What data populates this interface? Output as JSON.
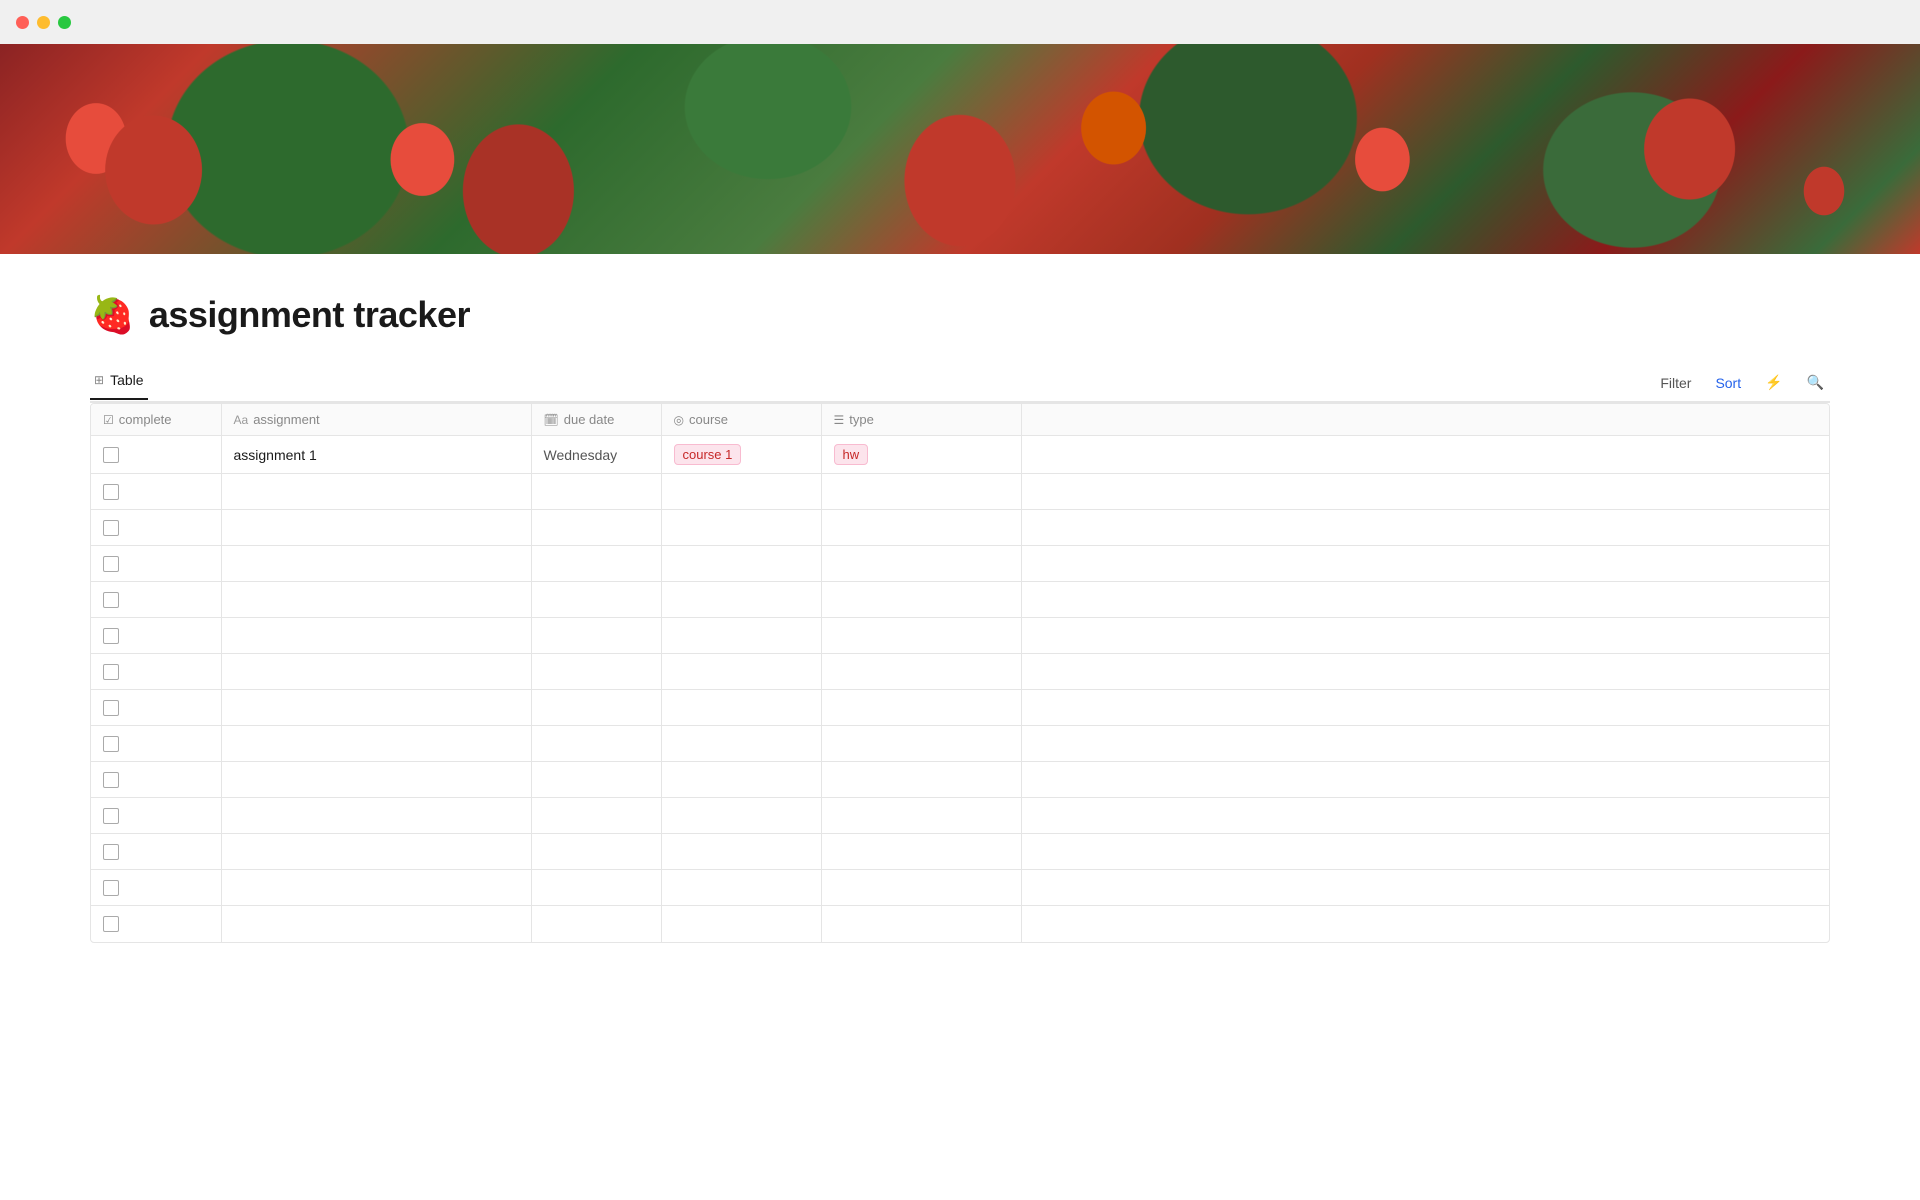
{
  "titleBar": {
    "trafficLights": [
      "red",
      "yellow",
      "green"
    ]
  },
  "banner": {
    "altText": "Raspberry botanical illustration banner"
  },
  "page": {
    "emoji": "🍓",
    "title": "assignment tracker"
  },
  "tabs": [
    {
      "id": "table",
      "label": "Table",
      "icon": "⊞",
      "active": true
    }
  ],
  "toolbar": {
    "filterLabel": "Filter",
    "sortLabel": "Sort",
    "lightningIcon": "⚡",
    "searchIcon": "🔍"
  },
  "table": {
    "columns": [
      {
        "id": "complete",
        "icon": "☑",
        "label": "complete"
      },
      {
        "id": "assignment",
        "icon": "Aa",
        "label": "assignment"
      },
      {
        "id": "duedate",
        "icon": "📅",
        "label": "due date"
      },
      {
        "id": "course",
        "icon": "⊙",
        "label": "course"
      },
      {
        "id": "type",
        "icon": "≡",
        "label": "type"
      }
    ],
    "rows": [
      {
        "id": 1,
        "complete": false,
        "assignment": "assignment 1",
        "dueDate": "Wednesday",
        "course": "course 1",
        "type": "hw"
      },
      {
        "id": 2,
        "complete": false,
        "assignment": "",
        "dueDate": "",
        "course": "",
        "type": ""
      },
      {
        "id": 3,
        "complete": false,
        "assignment": "",
        "dueDate": "",
        "course": "",
        "type": ""
      },
      {
        "id": 4,
        "complete": false,
        "assignment": "",
        "dueDate": "",
        "course": "",
        "type": ""
      },
      {
        "id": 5,
        "complete": false,
        "assignment": "",
        "dueDate": "",
        "course": "",
        "type": ""
      },
      {
        "id": 6,
        "complete": false,
        "assignment": "",
        "dueDate": "",
        "course": "",
        "type": ""
      },
      {
        "id": 7,
        "complete": false,
        "assignment": "",
        "dueDate": "",
        "course": "",
        "type": ""
      },
      {
        "id": 8,
        "complete": false,
        "assignment": "",
        "dueDate": "",
        "course": "",
        "type": ""
      },
      {
        "id": 9,
        "complete": false,
        "assignment": "",
        "dueDate": "",
        "course": "",
        "type": ""
      },
      {
        "id": 10,
        "complete": false,
        "assignment": "",
        "dueDate": "",
        "course": "",
        "type": ""
      },
      {
        "id": 11,
        "complete": false,
        "assignment": "",
        "dueDate": "",
        "course": "",
        "type": ""
      },
      {
        "id": 12,
        "complete": false,
        "assignment": "",
        "dueDate": "",
        "course": "",
        "type": ""
      },
      {
        "id": 13,
        "complete": false,
        "assignment": "",
        "dueDate": "",
        "course": "",
        "type": ""
      },
      {
        "id": 14,
        "complete": false,
        "assignment": "",
        "dueDate": "",
        "course": "",
        "type": ""
      }
    ]
  }
}
